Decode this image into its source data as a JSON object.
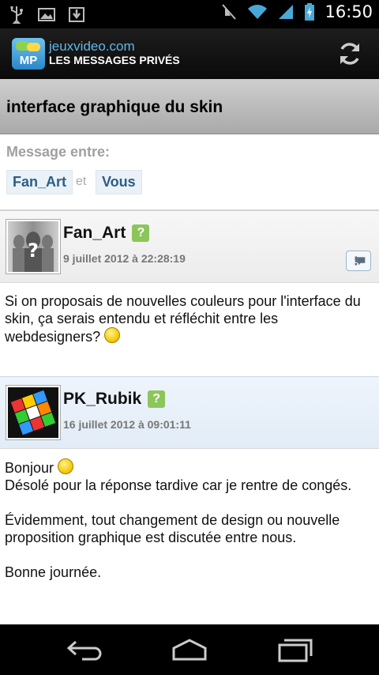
{
  "status_bar": {
    "time": "16:50",
    "icons": [
      "usb-icon",
      "image-icon",
      "download-icon",
      "mute-icon",
      "wifi-icon",
      "signal-icon",
      "battery-charging-icon"
    ]
  },
  "app_header": {
    "site": "jeuxvideo.com",
    "subtitle": "LES MESSAGES PRIVÉS",
    "logo_text": "MP",
    "refresh_icon": "refresh-icon"
  },
  "thread": {
    "title": "interface graphique du skin",
    "participants_label": "Message entre:",
    "participant_1": "Fan_Art",
    "conjunction": "et",
    "participant_2": "Vous"
  },
  "messages": [
    {
      "author": "Fan_Art",
      "badge": "?",
      "date": "9 juillet 2012 à 22:28:19",
      "body": [
        "Si on proposais de nouvelles couleurs pour l'interface du skin, ça serais entendu et réfléchit entre les webdesigners?"
      ]
    },
    {
      "author": "PK_Rubik",
      "badge": "?",
      "date": "16 juillet 2012 à 09:01:11",
      "line_1": "Bonjour",
      "line_2": "Désolé pour la réponse tardive car je rentre de congés.",
      "para_2": "Évidemment, tout changement de design ou nouvelle proposition graphique est discutée entre nous.",
      "para_3": "Bonne journée."
    }
  ],
  "colors": {
    "brand_blue": "#5fb8ec",
    "badge_green": "#8cc65a",
    "chip_text": "#2c5e86"
  },
  "nav_bar": [
    "back-icon",
    "home-icon",
    "recent-apps-icon"
  ]
}
